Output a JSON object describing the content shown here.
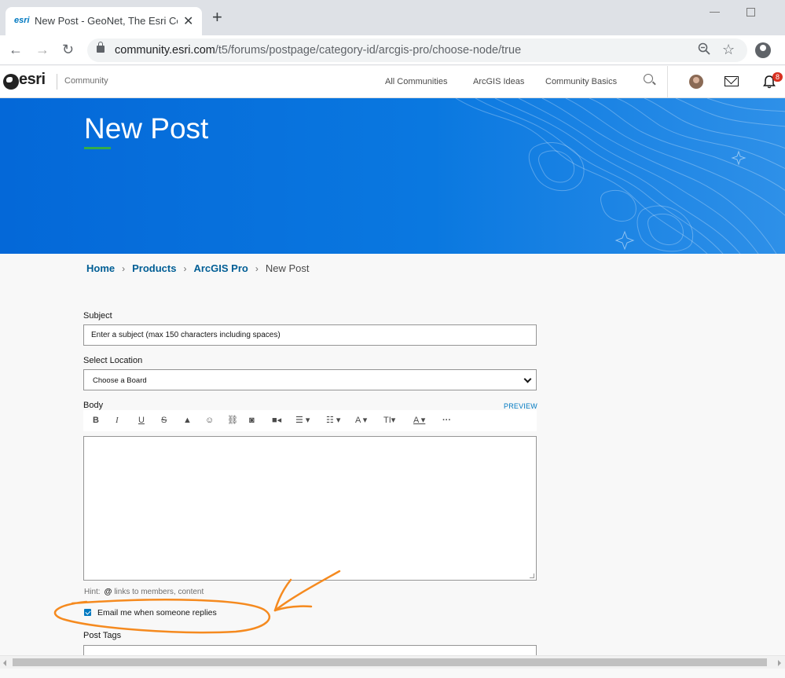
{
  "browser": {
    "tab": {
      "favicon_text": "esri",
      "title": "New Post - GeoNet, The Esri Community",
      "close_glyph": "✕"
    },
    "new_tab_glyph": "+",
    "url": {
      "host": "community.esri.com",
      "path": "/t5/forums/postpage/category-id/arcgis-pro/choose-node/true"
    },
    "icons": {
      "back": "←",
      "forward": "→",
      "reload": "↻",
      "zoom": "zoom-icon",
      "bookmark": "☆"
    }
  },
  "site_header": {
    "logo_text": "esri",
    "section_label": "Community",
    "nav": [
      "All Communities",
      "ArcGIS Ideas",
      "Community Basics"
    ],
    "notification_count": "8"
  },
  "banner": {
    "title": "New Post"
  },
  "breadcrumb": {
    "items": [
      "Home",
      "Products",
      "ArcGIS Pro"
    ],
    "current": "New Post",
    "separator": "›"
  },
  "form": {
    "subject_label": "Subject",
    "subject_placeholder": "Enter a subject (max 150 characters including spaces)",
    "location_label": "Select Location",
    "location_value": "Choose a Board",
    "body_label": "Body",
    "preview_label": "PREVIEW",
    "hint_prefix": "Hint:",
    "hint_at": "@",
    "hint_text": "links to members, content",
    "email_label": "Email me when someone replies",
    "email_checked": true,
    "tags_label": "Post Tags"
  },
  "colors": {
    "brand_blue": "#0079c1",
    "banner_blue": "#0468d8",
    "accent_green": "#35ac46",
    "annotation_orange": "#f58a1f"
  }
}
